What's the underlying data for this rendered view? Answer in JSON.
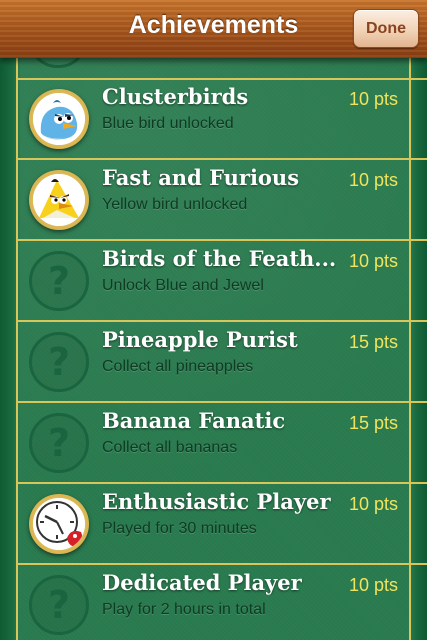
{
  "navbar": {
    "title": "Achievements",
    "done_label": "Done"
  },
  "colors": {
    "felt": "#2b7c50",
    "gold_line": "#d9c65a",
    "points_text": "#f0e45e",
    "subtitle_text": "#0f3a23",
    "wood": "#a8561c"
  },
  "achievements": [
    {
      "title": "Clusterbirds",
      "description": "Blue bird unlocked",
      "points": "10 pts",
      "unlocked": true,
      "icon": "blue-bird-icon"
    },
    {
      "title": "Fast and Furious",
      "description": "Yellow bird unlocked",
      "points": "10 pts",
      "unlocked": true,
      "icon": "yellow-bird-icon"
    },
    {
      "title": "Birds of the Feath...",
      "description": "Unlock Blue and Jewel",
      "points": "10 pts",
      "unlocked": false,
      "icon": "question-mark-icon"
    },
    {
      "title": "Pineapple Purist",
      "description": "Collect all pineapples",
      "points": "15 pts",
      "unlocked": false,
      "icon": "question-mark-icon"
    },
    {
      "title": "Banana Fanatic",
      "description": "Collect all bananas",
      "points": "15 pts",
      "unlocked": false,
      "icon": "question-mark-icon"
    },
    {
      "title": "Enthusiastic Player",
      "description": "Played for 30 minutes",
      "points": "10 pts",
      "unlocked": true,
      "icon": "clock-icon"
    },
    {
      "title": "Dedicated Player",
      "description": "Play for 2 hours in total",
      "points": "10 pts",
      "unlocked": false,
      "icon": "question-mark-icon"
    }
  ]
}
